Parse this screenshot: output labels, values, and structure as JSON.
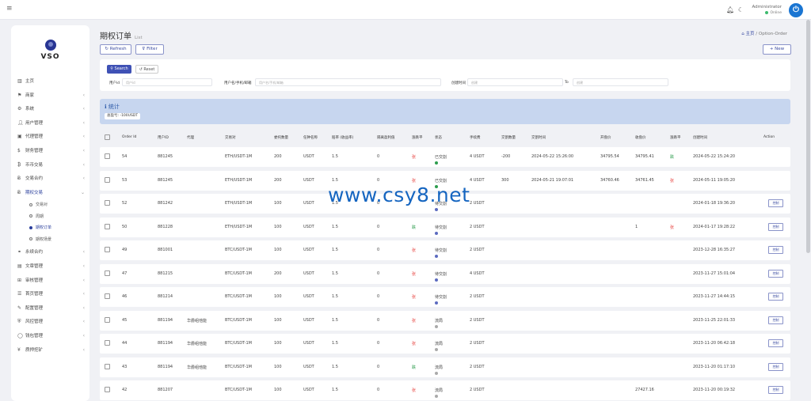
{
  "topbar": {
    "user": "Administrator",
    "status": "Online",
    "avatar_letter": "⏻"
  },
  "logo": {
    "text": "VSO"
  },
  "sidebar": {
    "items": [
      {
        "label": "主页",
        "icon": "chart-icon",
        "arrow": false
      },
      {
        "label": "商家",
        "icon": "merchant-icon",
        "arrow": true
      },
      {
        "label": "系统",
        "icon": "gear-icon",
        "arrow": true
      },
      {
        "label": "用户管理",
        "icon": "user-icon",
        "arrow": true
      },
      {
        "label": "代理管理",
        "icon": "agent-icon",
        "arrow": true
      },
      {
        "label": "财务管理",
        "icon": "dollar-icon",
        "arrow": true
      },
      {
        "label": "币币交易",
        "icon": "coin-icon",
        "arrow": true
      },
      {
        "label": "交易合约",
        "icon": "bitcoin-icon",
        "arrow": true
      },
      {
        "label": "期权交易",
        "icon": "bitcoin-icon",
        "arrow": true,
        "active": true
      }
    ],
    "sub_items": [
      {
        "label": "交易对",
        "active": false
      },
      {
        "label": "周期",
        "active": false
      },
      {
        "label": "期权订单",
        "active": true
      },
      {
        "label": "期权场景",
        "active": false
      }
    ],
    "items2": [
      {
        "label": "永续合约",
        "icon": "link-icon",
        "arrow": true
      },
      {
        "label": "文章管理",
        "icon": "article-icon",
        "arrow": true
      },
      {
        "label": "审核管理",
        "icon": "audit-icon",
        "arrow": true
      },
      {
        "label": "首页管理",
        "icon": "home-list-icon",
        "arrow": true
      },
      {
        "label": "配置管理",
        "icon": "wrench-icon",
        "arrow": true
      },
      {
        "label": "风控管理",
        "icon": "shield-icon",
        "arrow": true
      },
      {
        "label": "钱包管理",
        "icon": "wallet-icon",
        "arrow": true
      },
      {
        "label": "质押挖矿",
        "icon": "yen-icon",
        "arrow": true
      }
    ]
  },
  "page": {
    "title": "期权订单",
    "subtitle": "List",
    "crumb_home": "主页",
    "crumb_sep": "/",
    "crumb_current": "Option-Order"
  },
  "toolbar": {
    "refresh": "Refresh",
    "filter": "Filter",
    "new": "New"
  },
  "search": {
    "search_btn": "Search",
    "reset_btn": "Reset",
    "f1_label": "用户id",
    "f1_placeholder": "用户id",
    "f2_label": "用户名/手机/邮箱",
    "f2_placeholder": "用户名/手机/邮箱",
    "f3_label": "创建时间",
    "f3_from": "创建",
    "f3_sep": "To",
    "f3_to": "创建"
  },
  "stats": {
    "title": "统计",
    "badge": "总盈亏: -100USDT"
  },
  "table": {
    "headers": [
      "Order Id",
      "用户ID",
      "代理",
      "交易对",
      "委托数量",
      "任钟名称",
      "赔率 (收益率)",
      "隔离盈利值",
      "涨跌平",
      "状态",
      "手续费",
      "交割数量",
      "交割时间",
      "开盘价",
      "收盘价",
      "涨跌平",
      "创建时间",
      "Action"
    ],
    "rows": [
      {
        "id": "54",
        "uid": "881245",
        "agent": "",
        "pair": "ETH/USDT-1M",
        "qty": "200",
        "cur": "USDT",
        "odds": "1.5",
        "profit": "0",
        "dir": "张",
        "dir_color": "red",
        "status": "已交割",
        "status_color": "#2e9d4e",
        "fee": "4 USDT",
        "dq": "-200",
        "dt": "2024-05-22 15:26:00",
        "open": "34795.54",
        "close": "34795.41",
        "res": "跌",
        "res_color": "green",
        "created": "2024-05-22 15:24:20",
        "action": ""
      },
      {
        "id": "53",
        "uid": "881245",
        "agent": "",
        "pair": "ETH/USDT-1M",
        "qty": "200",
        "cur": "USDT",
        "odds": "1.5",
        "profit": "0",
        "dir": "张",
        "dir_color": "red",
        "status": "已交割",
        "status_color": "#2e9d4e",
        "fee": "4 USDT",
        "dq": "300",
        "dt": "2024-05-21 19:07:01",
        "open": "34760.46",
        "close": "34761.45",
        "res": "张",
        "res_color": "red",
        "created": "2024-05-11 19:05:20",
        "action": ""
      },
      {
        "id": "52",
        "uid": "881242",
        "agent": "",
        "pair": "ETH/USDT-1M",
        "qty": "100",
        "cur": "USDT",
        "odds": "1.5",
        "profit": "0",
        "dir": "",
        "dir_color": "red",
        "status": "待交割",
        "status_color": "#5c6bc0",
        "fee": "2 USDT",
        "dq": "",
        "dt": "",
        "open": "",
        "close": "",
        "res": "",
        "res_color": "red",
        "created": "2024-01-18 19:36:20",
        "action": "控制"
      },
      {
        "id": "50",
        "uid": "881228",
        "agent": "",
        "pair": "ETH/USDT-1M",
        "qty": "100",
        "cur": "USDT",
        "odds": "1.5",
        "profit": "0",
        "dir": "跌",
        "dir_color": "green",
        "status": "待交割",
        "status_color": "#5c6bc0",
        "fee": "2 USDT",
        "dq": "",
        "dt": "",
        "open": "",
        "close": "1",
        "res": "张",
        "res_color": "red",
        "created": "2024-01-17 19:28:22",
        "action": "控制"
      },
      {
        "id": "49",
        "uid": "881001",
        "agent": "",
        "pair": "BTC/USDT-1M",
        "qty": "100",
        "cur": "USDT",
        "odds": "1.5",
        "profit": "0",
        "dir": "张",
        "dir_color": "red",
        "status": "待交割",
        "status_color": "#5c6bc0",
        "fee": "2 USDT",
        "dq": "",
        "dt": "",
        "open": "",
        "close": "",
        "res": "",
        "res_color": "red",
        "created": "2023-12-28 16:35:27",
        "action": "控制"
      },
      {
        "id": "47",
        "uid": "881215",
        "agent": "",
        "pair": "BTC/USDT-1M",
        "qty": "200",
        "cur": "USDT",
        "odds": "1.5",
        "profit": "0",
        "dir": "张",
        "dir_color": "red",
        "status": "待交割",
        "status_color": "#5c6bc0",
        "fee": "4 USDT",
        "dq": "",
        "dt": "",
        "open": "",
        "close": "",
        "res": "",
        "res_color": "red",
        "created": "2023-11-27 15:01:04",
        "action": "控制"
      },
      {
        "id": "46",
        "uid": "881214",
        "agent": "",
        "pair": "BTC/USDT-1M",
        "qty": "100",
        "cur": "USDT",
        "odds": "1.5",
        "profit": "0",
        "dir": "张",
        "dir_color": "red",
        "status": "待交割",
        "status_color": "#5c6bc0",
        "fee": "2 USDT",
        "dq": "",
        "dt": "",
        "open": "",
        "close": "",
        "res": "",
        "res_color": "red",
        "created": "2023-11-27 14:44:15",
        "action": "控制"
      },
      {
        "id": "45",
        "uid": "881194",
        "agent": "华爵组他能",
        "pair": "BTC/USDT-1M",
        "qty": "100",
        "cur": "USDT",
        "odds": "1.5",
        "profit": "0",
        "dir": "张",
        "dir_color": "red",
        "status": "流局",
        "status_color": "#aaaaaa",
        "fee": "2 USDT",
        "dq": "",
        "dt": "",
        "open": "",
        "close": "",
        "res": "",
        "res_color": "red",
        "created": "2023-11-25 22:01:33",
        "action": "控制"
      },
      {
        "id": "44",
        "uid": "881194",
        "agent": "华爵组他能",
        "pair": "BTC/USDT-1M",
        "qty": "100",
        "cur": "USDT",
        "odds": "1.5",
        "profit": "0",
        "dir": "张",
        "dir_color": "red",
        "status": "流局",
        "status_color": "#aaaaaa",
        "fee": "2 USDT",
        "dq": "",
        "dt": "",
        "open": "",
        "close": "",
        "res": "",
        "res_color": "red",
        "created": "2023-11-20 06:42:18",
        "action": "控制"
      },
      {
        "id": "43",
        "uid": "881194",
        "agent": "华爵组他能",
        "pair": "BTC/USDT-1M",
        "qty": "100",
        "cur": "USDT",
        "odds": "1.5",
        "profit": "0",
        "dir": "跌",
        "dir_color": "green",
        "status": "流局",
        "status_color": "#aaaaaa",
        "fee": "2 USDT",
        "dq": "",
        "dt": "",
        "open": "",
        "close": "",
        "res": "",
        "res_color": "red",
        "created": "2023-11-20 01:17:10",
        "action": "控制"
      },
      {
        "id": "42",
        "uid": "881207",
        "agent": "",
        "pair": "BTC/USDT-1M",
        "qty": "100",
        "cur": "USDT",
        "odds": "1.5",
        "profit": "0",
        "dir": "张",
        "dir_color": "red",
        "status": "流局",
        "status_color": "#aaaaaa",
        "fee": "2 USDT",
        "dq": "",
        "dt": "",
        "open": "",
        "close": "27427.16",
        "res": "",
        "res_color": "red",
        "created": "2023-11-20 00:19:32",
        "action": "控制"
      }
    ]
  },
  "watermark": "www.csy8.net",
  "colors": {
    "accent": "#2a3f9c",
    "stats_bg": "#c7d6ef"
  }
}
